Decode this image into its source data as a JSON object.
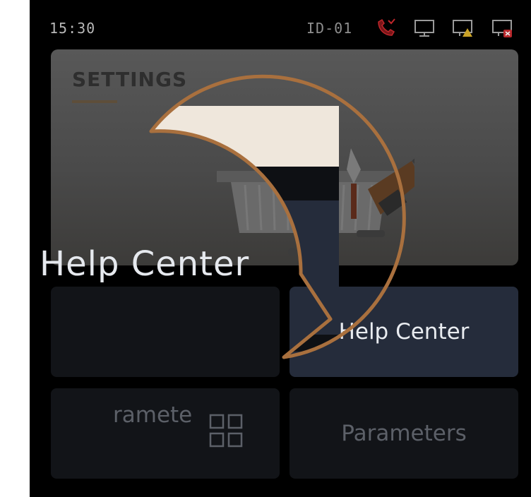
{
  "status_bar": {
    "time": "15:30",
    "device_id": "ID-01",
    "icons": [
      "missed-call-icon",
      "monitor-icon",
      "monitor-warning-icon",
      "monitor-error-icon"
    ]
  },
  "banner": {
    "title": "SETTINGS",
    "page_count": 2,
    "active_page": 2
  },
  "tiles": {
    "help_center": "Help Center",
    "parameters": "Parameters",
    "left_bottom_partial": "ramete"
  },
  "magnifier": {
    "label": "Help Center"
  },
  "colors": {
    "background": "#000000",
    "tile_active": "#252c3b",
    "tile_dim": "#121418",
    "accent_dot": "#1f3fb4",
    "magnifier_ring": "#a9703e",
    "missed_call": "#c0262b"
  }
}
